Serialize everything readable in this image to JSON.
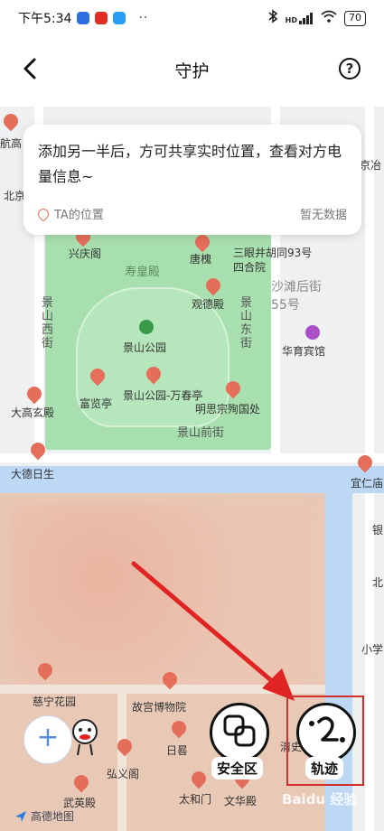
{
  "status_bar": {
    "time": "下午5:34",
    "dots": "··",
    "signal": "HD",
    "battery": "70"
  },
  "header": {
    "title": "守护",
    "help": "?"
  },
  "info_card": {
    "message": "添加另一半后，方可共享实时位置，查看对方电量信息~",
    "location_label": "TA的位置",
    "no_data": "暂无数据"
  },
  "map": {
    "pois": [
      "航高",
      "兴庆阁",
      "寿皇殿",
      "唐槐",
      "三眼井胡同93号四合院",
      "沙滩后街55号",
      "观德殿",
      "景山公园",
      "华育宾馆",
      "大高玄殿",
      "富览亭",
      "景山公园-万春亭",
      "明思宗殉国处",
      "大德日生",
      "景山前街",
      "宜仁庙",
      "慈宁花园",
      "故宫博物院",
      "日晷",
      "弘义阁",
      "太和门",
      "文华殿",
      "武英殿",
      "清史",
      "京冶",
      "北京"
    ],
    "streets": [
      "景山西街",
      "景山东街",
      "景山前街"
    ],
    "edge_labels": [
      "银",
      "北",
      "小学"
    ]
  },
  "controls": {
    "add": "+",
    "safe_zone": "安全区",
    "track": "轨迹"
  },
  "brand": "高德地图",
  "watermark": "Baidu 经验",
  "colors": {
    "highlight": "#d32f2f",
    "arrow": "#e02424",
    "poi": "#e46e5a",
    "park": "#a8dfae",
    "water": "#bcd8f5"
  }
}
